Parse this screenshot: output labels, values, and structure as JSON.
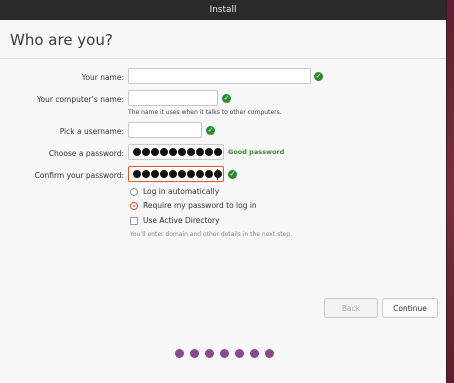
{
  "window": {
    "title": "Install"
  },
  "page": {
    "title": "Who are you?"
  },
  "form": {
    "name": {
      "label": "Your name:",
      "value": ""
    },
    "computer": {
      "label": "Your computer’s name:",
      "value": "",
      "hint": "The name it uses when it talks to other computers."
    },
    "username": {
      "label": "Pick a username:",
      "value": ""
    },
    "password": {
      "label": "Choose a password:",
      "masked_length": 10,
      "strength": "Good password"
    },
    "confirm": {
      "label": "Confirm your password:",
      "masked_length": 10
    }
  },
  "login": {
    "options": [
      {
        "label": "Log in automatically",
        "selected": false
      },
      {
        "label": "Require my password to log in",
        "selected": true
      }
    ],
    "active_directory": {
      "label": "Use Active Directory",
      "checked": false,
      "note": "You’ll enter domain and other details in the next step."
    }
  },
  "buttons": {
    "back": "Back",
    "continue": "Continue"
  },
  "progress": {
    "total_steps": 7
  },
  "icons": {
    "valid": "check-circle-icon"
  },
  "colors": {
    "accent": "#e95420",
    "valid": "#2b8a2b",
    "progress": "#8a4a8a"
  }
}
